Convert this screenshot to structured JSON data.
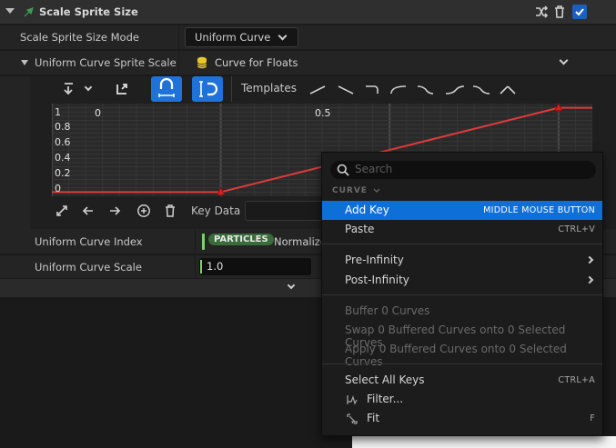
{
  "section": {
    "title": "Scale Sprite Size"
  },
  "rows": {
    "mode_label": "Scale Sprite Size Mode",
    "mode_value": "Uniform Curve",
    "curve_label": "Uniform Curve Sprite Scale",
    "curve_type": "Curve for Floats",
    "index_label": "Uniform Curve Index",
    "index_badge": "PARTICLES",
    "index_value": "Normalize",
    "scale_label": "Uniform Curve Scale",
    "scale_value": "1.0"
  },
  "curve_editor": {
    "templates_label": "Templates",
    "key_data_label": "Key Data",
    "x_ticks": [
      "0",
      "0.5"
    ],
    "y_ticks": [
      "1",
      "0.8",
      "0.6",
      "0.4",
      "0.2",
      "0"
    ]
  },
  "chart_data": {
    "type": "line",
    "x": [
      0,
      1
    ],
    "y": [
      0,
      1
    ],
    "xlim": [
      -0.5,
      1.1
    ],
    "ylim": [
      -0.05,
      1.05
    ],
    "x_tick_labels": [
      "0",
      "0.5"
    ],
    "y_tick_labels": [
      "1",
      "0.8",
      "0.6",
      "0.4",
      "0.2",
      "0"
    ],
    "color": "#e03a3a"
  },
  "menu": {
    "search_placeholder": "Search",
    "section_label": "CURVE",
    "items": [
      {
        "label": "Add Key",
        "shortcut": "MIDDLE MOUSE BUTTON"
      },
      {
        "label": "Paste",
        "shortcut": "CTRL+V"
      },
      {
        "label": "Pre-Infinity",
        "shortcut": ""
      },
      {
        "label": "Post-Infinity",
        "shortcut": ""
      },
      {
        "label": "Buffer 0 Curves",
        "shortcut": ""
      },
      {
        "label": "Swap 0 Buffered Curves onto 0 Selected Curves",
        "shortcut": ""
      },
      {
        "label": "Apply 0 Buffered Curves onto 0 Selected Curves",
        "shortcut": ""
      },
      {
        "label": "Select All Keys",
        "shortcut": "CTRL+A"
      },
      {
        "label": "Filter...",
        "shortcut": ""
      },
      {
        "label": "Fit",
        "shortcut": "F"
      }
    ]
  },
  "colors": {
    "accent": "#1f73d8",
    "curve": "#e03a3a",
    "badge": "#3a6b3a"
  }
}
